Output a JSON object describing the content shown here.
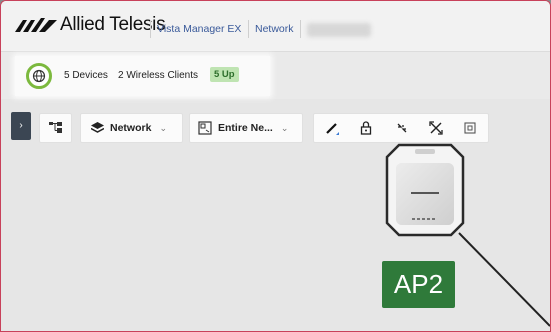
{
  "header": {
    "brand": "Allied Telesis",
    "app_name": "Vista Manager EX",
    "section": "Network"
  },
  "summary": {
    "devices": "5 Devices",
    "wireless": "2 Wireless Clients",
    "up_badge": "5 Up"
  },
  "toolbar": {
    "layer_label": "Network",
    "scope_label": "Entire Ne..."
  },
  "canvas": {
    "node_label": "AP2"
  },
  "colors": {
    "accent_green": "#7cb93e",
    "badge_green": "#2f7a3a",
    "link_blue": "#3a5a9a",
    "frame_border": "#c8415a"
  },
  "icons": [
    "allied-telesis-logo",
    "globe-icon",
    "expand-panel-icon",
    "topology-tree-icon",
    "layers-icon",
    "chevron-down-icon",
    "map-view-icon",
    "pencil-icon",
    "lock-icon",
    "collapse-icon",
    "expand-icon",
    "fit-icon",
    "access-point-icon"
  ]
}
